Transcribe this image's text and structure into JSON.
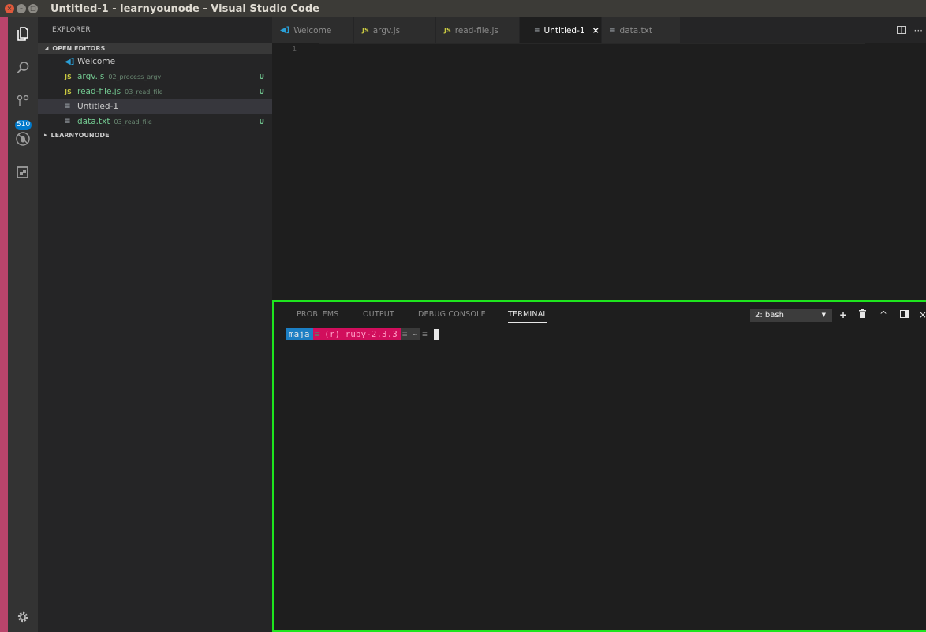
{
  "window": {
    "title": "Untitled-1 - learnyounode - Visual Studio Code",
    "close_glyph": "×",
    "min_glyph": "–",
    "max_glyph": "□"
  },
  "activity": {
    "source_control_badge": "510",
    "icons": [
      "files-icon",
      "search-icon",
      "source-control-icon",
      "debug-icon",
      "extensions-icon",
      "settings-gear-icon"
    ]
  },
  "sidebar": {
    "title": "EXPLORER",
    "open_editors_header": "OPEN EDITORS",
    "project_header": "LEARNYOUNODE",
    "open_editors": [
      {
        "name": "Welcome",
        "path": "",
        "status": "",
        "icon": "vscode-icon"
      },
      {
        "name": "argv.js",
        "path": "02_process_argv",
        "status": "U",
        "icon": "js-icon"
      },
      {
        "name": "read-file.js",
        "path": "03_read_file",
        "status": "U",
        "icon": "js-icon"
      },
      {
        "name": "Untitled-1",
        "path": "",
        "status": "",
        "icon": "text-file-icon"
      },
      {
        "name": "data.txt",
        "path": "03_read_file",
        "status": "U",
        "icon": "text-file-icon"
      }
    ]
  },
  "tabs": [
    {
      "label": "Welcome",
      "icon_text": "◀]"
    },
    {
      "label": "argv.js",
      "icon_text": "JS"
    },
    {
      "label": "read-file.js",
      "icon_text": "JS"
    },
    {
      "label": "Untitled-1",
      "icon_text": "≡",
      "close": "×"
    },
    {
      "label": "data.txt",
      "icon_text": "≡"
    }
  ],
  "editor": {
    "line_number": "1"
  },
  "panel": {
    "tabs": [
      "PROBLEMS",
      "OUTPUT",
      "DEBUG CONSOLE",
      "TERMINAL"
    ],
    "active_tab": "TERMINAL",
    "terminal_selector": "2: bash",
    "selector_arrow": "▼",
    "actions": {
      "add": "+",
      "trash": "🗑",
      "maximize": "^",
      "split": "◨",
      "close": "×"
    }
  },
  "terminal": {
    "user": "maja",
    "ruby": "(r) ruby-2.3.3",
    "dir": "~",
    "separator": "≡"
  },
  "colors": {
    "accent": "#007acc",
    "highlight_border": "#1ee51e",
    "ruby_segment": "#d10e5c",
    "user_segment": "#1c7fc4"
  }
}
